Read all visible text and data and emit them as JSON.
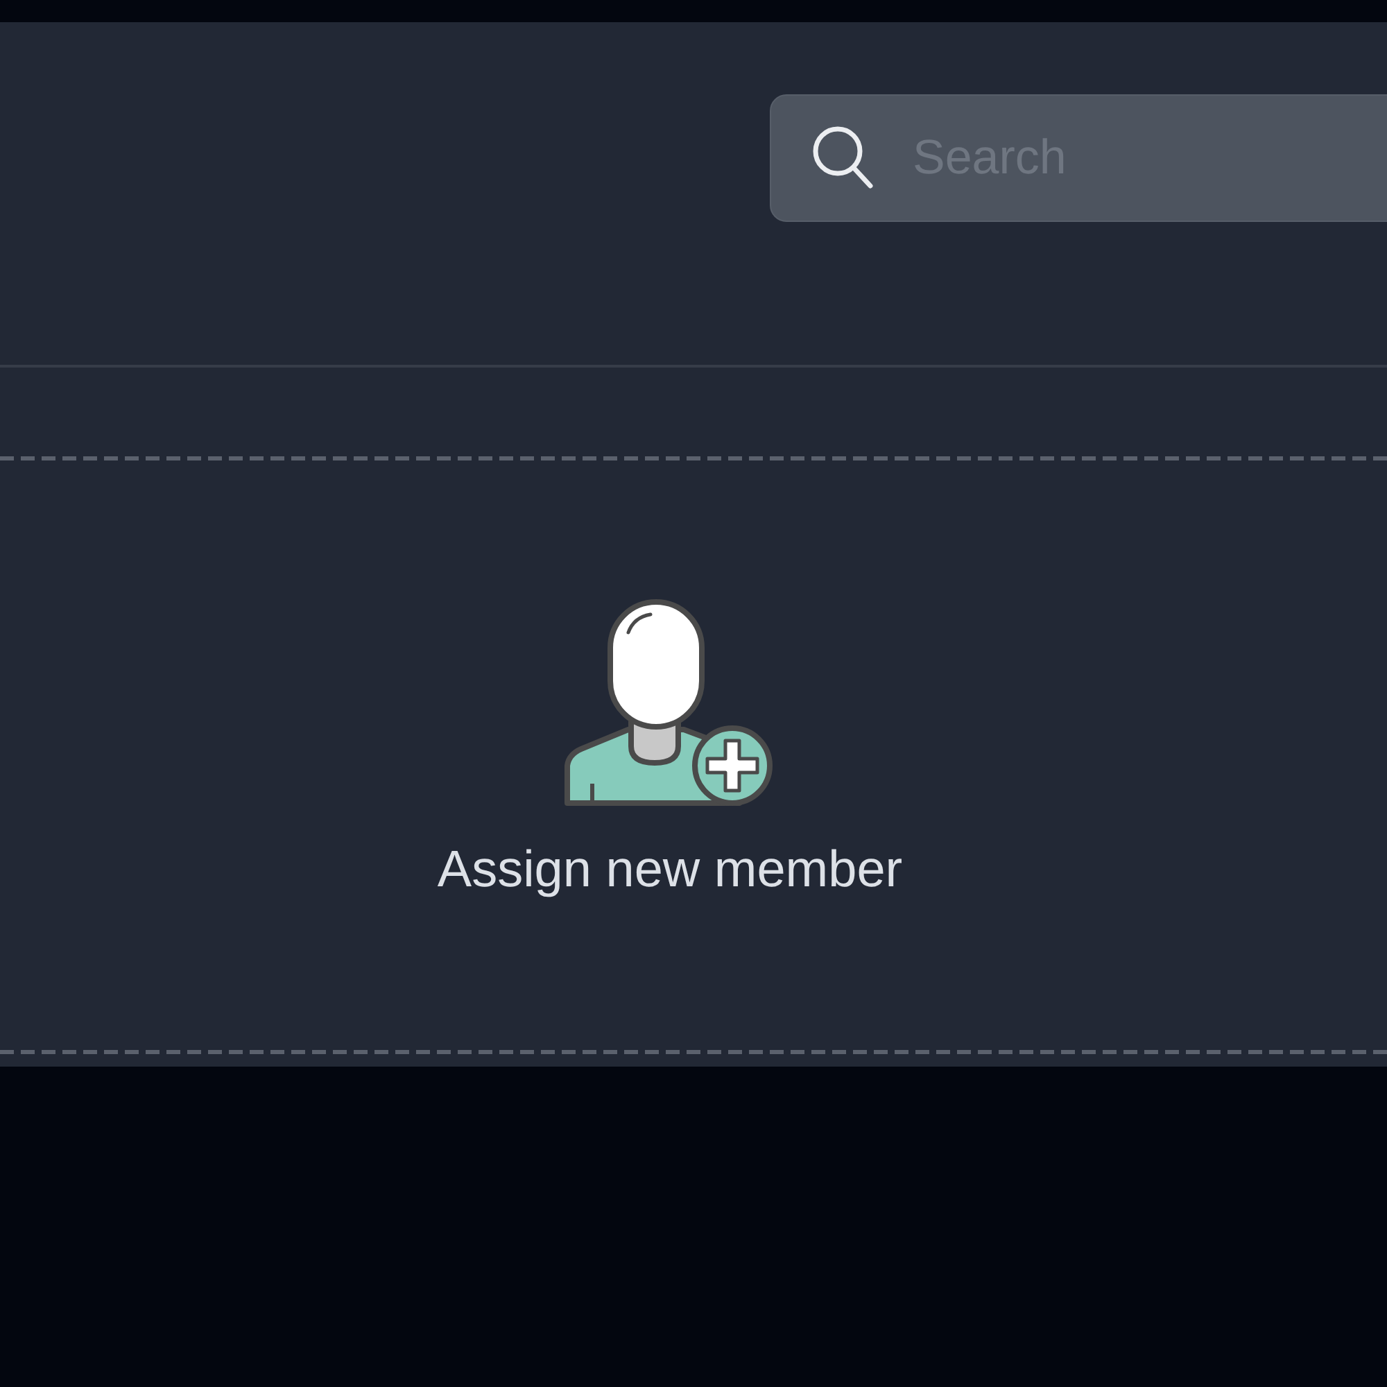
{
  "search": {
    "placeholder": "Search"
  },
  "assign": {
    "label": "Assign new member"
  }
}
